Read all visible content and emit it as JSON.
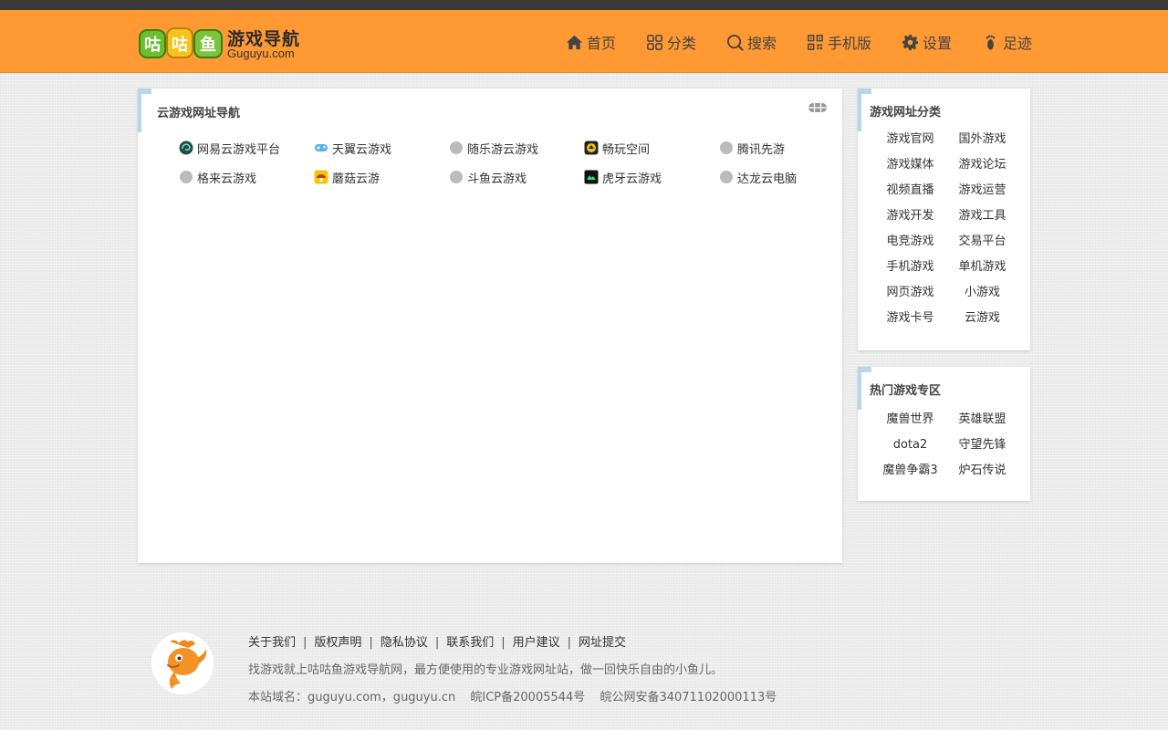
{
  "header": {
    "logo_mark_text": "咕咕鱼",
    "site_title": "游戏导航",
    "site_domain": "Guguyu.com",
    "nav": [
      {
        "label": "首页",
        "icon": "home-icon"
      },
      {
        "label": "分类",
        "icon": "grid-icon"
      },
      {
        "label": "搜索",
        "icon": "search-icon"
      },
      {
        "label": "手机版",
        "icon": "qrcode-icon"
      },
      {
        "label": "设置",
        "icon": "gear-icon"
      },
      {
        "label": "足迹",
        "icon": "footprint-icon"
      }
    ]
  },
  "main": {
    "title": "云游戏网址导航",
    "links": [
      {
        "label": "网易云游戏平台",
        "icon": "netease-icon"
      },
      {
        "label": "天翼云游戏",
        "icon": "tianyi-icon"
      },
      {
        "label": "随乐游云游戏",
        "icon": "default-site-icon"
      },
      {
        "label": "畅玩空间",
        "icon": "changwan-icon"
      },
      {
        "label": "腾讯先游",
        "icon": "default-site-icon"
      },
      {
        "label": "格来云游戏",
        "icon": "default-site-icon"
      },
      {
        "label": "蘑菇云游",
        "icon": "mogu-icon"
      },
      {
        "label": "斗鱼云游戏",
        "icon": "default-site-icon"
      },
      {
        "label": "虎牙云游戏",
        "icon": "huya-icon"
      },
      {
        "label": "达龙云电脑",
        "icon": "default-site-icon"
      }
    ]
  },
  "categories": {
    "title": "游戏网址分类",
    "items": [
      "游戏官网",
      "国外游戏",
      "游戏媒体",
      "游戏论坛",
      "视频直播",
      "游戏运营",
      "游戏开发",
      "游戏工具",
      "电竞游戏",
      "交易平台",
      "手机游戏",
      "单机游戏",
      "网页游戏",
      "小游戏",
      "游戏卡号",
      "云游戏"
    ]
  },
  "hot": {
    "title": "热门游戏专区",
    "items": [
      "魔兽世界",
      "英雄联盟",
      "dota2",
      "守望先锋",
      "魔兽争霸3",
      "炉石传说"
    ]
  },
  "footer": {
    "links": [
      "关于我们",
      "版权声明",
      "隐私协议",
      "联系我们",
      "用户建议",
      "网址提交"
    ],
    "separator": "|",
    "description": "找游戏就上咕咕鱼游戏导航网，最方便使用的专业游戏网址站，做一回快乐自由的小鱼儿。",
    "domains": "本站域名：guguyu.com，guguyu.cn",
    "icp": "皖ICP备20005544号",
    "police": "皖公网安备34071102000113号"
  },
  "colors": {
    "header_bg": "#ff9933",
    "top_strip": "#3a3a3a",
    "accent_bar": "#b8d6ea",
    "page_bg": "#ececec"
  }
}
